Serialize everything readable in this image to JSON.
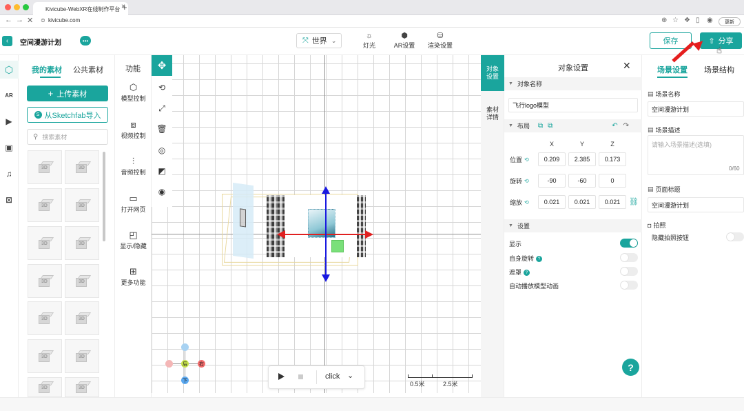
{
  "browser": {
    "tab_title": "Kivicube-WebXR在线制作平台",
    "new_tab_label": "+",
    "url": "kivicube.com",
    "update_label": "更新"
  },
  "header": {
    "project_title": "空间漫游计划",
    "world_select": "世界",
    "tools": [
      {
        "label": "灯光",
        "icon": "sun-icon"
      },
      {
        "label": "AR设置",
        "icon": "ar-icon"
      },
      {
        "label": "渲染设置",
        "icon": "paint-bucket-icon"
      }
    ],
    "save_label": "保存",
    "share_label": "分享"
  },
  "assets": {
    "tabs": [
      "我的素材",
      "公共素材"
    ],
    "active_tab": "我的素材",
    "upload_label": "上传素材",
    "sketchfab_label": "从Sketchfab导入",
    "search_placeholder": "搜索素材",
    "thumb_label": "3D"
  },
  "functions": {
    "title": "功能",
    "items": [
      {
        "label": "模型控制",
        "icon": "cube-icon"
      },
      {
        "label": "视频控制",
        "icon": "video-icon"
      },
      {
        "label": "音频控制",
        "icon": "sliders-icon"
      },
      {
        "label": "打开网页",
        "icon": "screen-icon"
      },
      {
        "label": "显示/隐藏",
        "icon": "toggle-box-icon"
      },
      {
        "label": "更多功能",
        "icon": "grid-icon"
      }
    ]
  },
  "viewport": {
    "gizmo": {
      "back": "后",
      "right": "右",
      "down": "下"
    },
    "playbar": {
      "event": "click"
    },
    "scale": [
      "0.5米",
      "2.5米"
    ]
  },
  "object_settings": {
    "side_tabs": [
      "对象设置",
      "素材详情"
    ],
    "title": "对象设置",
    "name_section": "对象名称",
    "object_name": "飞行logo模型",
    "layout_section": "布局",
    "axes": [
      "X",
      "Y",
      "Z"
    ],
    "position_label": "位置",
    "position": [
      "0.209",
      "2.385",
      "0.173"
    ],
    "rotation_label": "旋转",
    "rotation": [
      "-90",
      "-60",
      "0"
    ],
    "scale_label": "缩放",
    "scale": [
      "0.021",
      "0.021",
      "0.021"
    ],
    "settings_section": "设置",
    "toggles": [
      {
        "label": "显示",
        "on": true,
        "help": false
      },
      {
        "label": "自身旋转",
        "on": false,
        "help": true
      },
      {
        "label": "遮罩",
        "on": false,
        "help": true
      },
      {
        "label": "自动播放模型动画",
        "on": false,
        "help": false
      }
    ]
  },
  "scene": {
    "tabs": [
      "场景设置",
      "场景结构"
    ],
    "active_tab": "场景设置",
    "name_label": "场景名称",
    "name_value": "空间漫游计划",
    "desc_label": "场景描述",
    "desc_placeholder": "请输入场景描述(选填)",
    "desc_count": "0/60",
    "page_title_label": "页面标题",
    "page_title_value": "空间漫游计划",
    "photo_label": "拍照",
    "hide_photo_label": "隐藏拍照按钮",
    "hide_photo_on": false
  },
  "colors": {
    "accent": "#1aa59d",
    "annotation_arrow": "#e51e1e"
  }
}
